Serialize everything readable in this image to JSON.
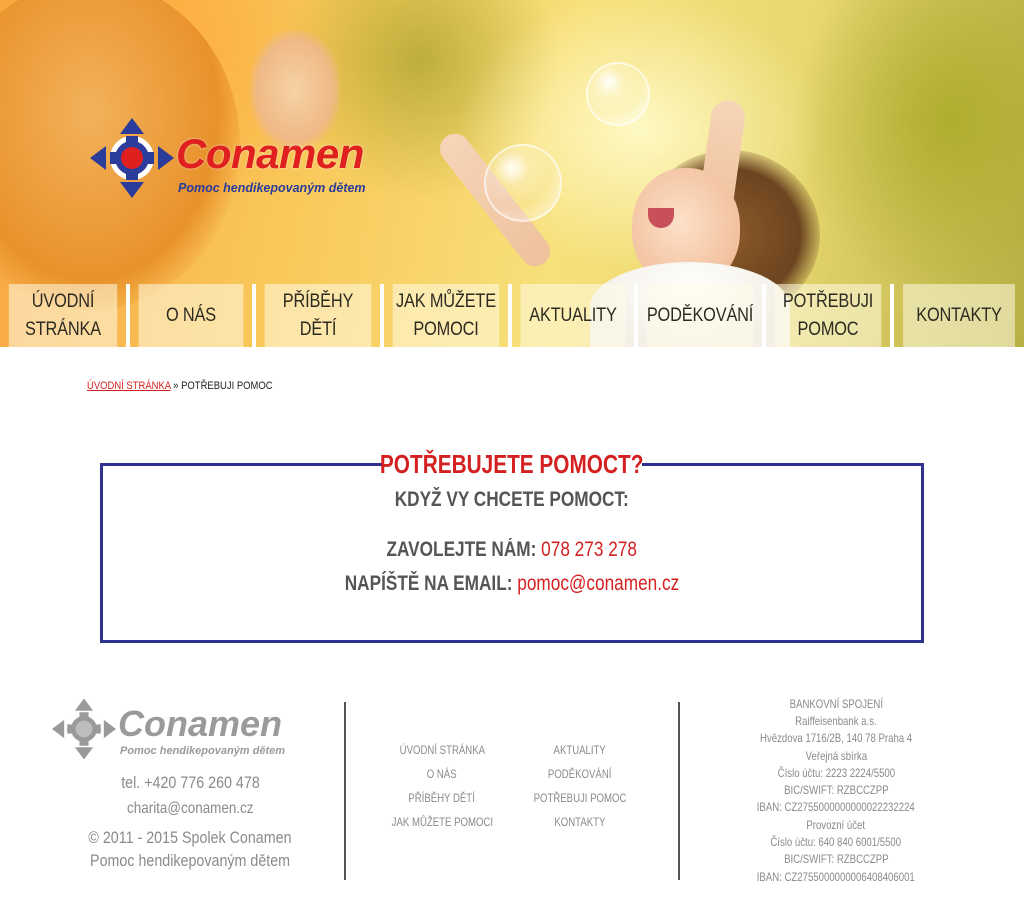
{
  "logo": {
    "brand": "Conamen",
    "tagline": "Pomoc hendikepovaným dětem",
    "colors": {
      "brand": "#e0201f",
      "tagline": "#2b3c9a",
      "mark": "#2b3c9a"
    }
  },
  "nav": {
    "items": [
      {
        "label": "ÚVODNÍ\nSTRÁNKA",
        "line1": "ÚVODNÍ",
        "line2": "STRÁNKA"
      },
      {
        "label": "O NÁS",
        "line1": "O NÁS",
        "line2": ""
      },
      {
        "label": "PŘÍBĚHY\nDĚTÍ",
        "line1": "PŘÍBĚHY",
        "line2": "DĚTÍ"
      },
      {
        "label": "JAK MŮŽETE\nPOMOCI",
        "line1": "JAK MŮŽETE",
        "line2": "POMOCI"
      },
      {
        "label": "AKTUALITY",
        "line1": "AKTUALITY",
        "line2": ""
      },
      {
        "label": "PODĚKOVÁNÍ",
        "line1": "PODĚKOVÁNÍ",
        "line2": ""
      },
      {
        "label": "POTŘEBUJI\nPOMOC",
        "line1": "POTŘEBUJI",
        "line2": "POMOC"
      },
      {
        "label": "KONTAKTY",
        "line1": "KONTAKTY",
        "line2": ""
      }
    ]
  },
  "breadcrumb": {
    "home": "Úvodní stránka",
    "separator": "»",
    "current": "Potřebuji pomoc"
  },
  "help": {
    "title": "POTŘEBUJETE POMOCT?",
    "subtitle": "KDYŽ VY CHCETE POMOCT:",
    "call_label": "ZAVOLEJTE NÁM:",
    "phone": "078 273 278",
    "email_label": "NAPÍŠTĚ NA EMAIL:",
    "email": "pomoc@conamen.cz",
    "colors": {
      "accent": "#d42020",
      "border": "#2e3190"
    }
  },
  "footer": {
    "logo": {
      "brand": "Conamen",
      "tagline": "Pomoc hendikepovaným dětem"
    },
    "tel": "tel. +420 776 260 478",
    "email": "charita@conamen.cz",
    "copyright": "© 2011 - 2015 Spolek Conamen",
    "org": "Pomoc hendikepovaným dětem",
    "links_left": [
      "ÚVODNÍ STRÁNKA",
      "O NÁS",
      "PŘÍBĚHY DĚTÍ",
      "JAK MŮŽETE POMOCI"
    ],
    "links_right": [
      "AKTUALITY",
      "PODĚKOVÁNÍ",
      "POTŘEBUJI POMOC",
      "KONTAKTY"
    ],
    "bank_lines": [
      "BANKOVNÍ SPOJENÍ",
      "Raiffeisenbank a.s.",
      "Hvězdova 1716/2B, 140 78 Praha 4",
      "Veřejná sbírka",
      "Číslo účtu: 2223 2224/5500",
      "BIC/SWIFT: RZBCCZPP",
      "IBAN: CZ2755000000000022232224",
      "Provozní účet",
      "Číslo účtu: 640 840 6001/5500",
      "BIC/SWIFT: RZBCCZPP",
      "IBAN: CZ2755000000006408406001"
    ]
  }
}
